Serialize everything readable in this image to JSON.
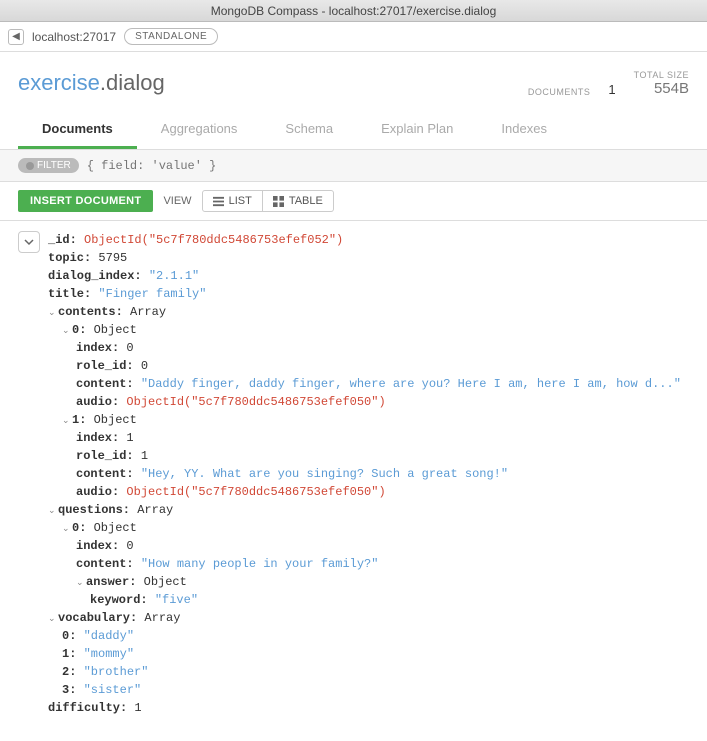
{
  "window": {
    "title": "MongoDB Compass - localhost:27017/exercise.dialog"
  },
  "connection": {
    "back_icon": "◀",
    "host": "localhost:27017",
    "mode": "STANDALONE"
  },
  "namespace": {
    "db": "exercise",
    "coll": ".dialog"
  },
  "stats": {
    "documents_label": "DOCUMENTS",
    "documents_value": "1",
    "size_label": "TOTAL SIZE",
    "size_value": "554B"
  },
  "tabs": {
    "documents": "Documents",
    "aggregations": "Aggregations",
    "schema": "Schema",
    "explain": "Explain Plan",
    "indexes": "Indexes"
  },
  "filter": {
    "badge": "FILTER",
    "placeholder": "{ field: 'value' }"
  },
  "toolbar": {
    "insert": "INSERT DOCUMENT",
    "view_label": "VIEW",
    "list": "LIST",
    "table": "TABLE"
  },
  "doc": {
    "id_key": "_id:",
    "id_val": "ObjectId(\"5c7f780ddc5486753efef052\")",
    "topic_key": "topic:",
    "topic_val": "5795",
    "dialog_index_key": "dialog_index:",
    "dialog_index_val": "\"2.1.1\"",
    "title_key": "title:",
    "title_val": "\"Finger family\"",
    "contents_key": "contents:",
    "contents_type": "Array",
    "c0_key": "0:",
    "c0_type": "Object",
    "c0_index_key": "index:",
    "c0_index_val": "0",
    "c0_role_key": "role_id:",
    "c0_role_val": "0",
    "c0_content_key": "content:",
    "c0_content_val": "\"Daddy finger, daddy finger, where are you? Here I am, here I am, how d...\"",
    "c0_audio_key": "audio:",
    "c0_audio_val": "ObjectId(\"5c7f780ddc5486753efef050\")",
    "c1_key": "1:",
    "c1_type": "Object",
    "c1_index_key": "index:",
    "c1_index_val": "1",
    "c1_role_key": "role_id:",
    "c1_role_val": "1",
    "c1_content_key": "content:",
    "c1_content_val": "\"Hey, YY. What are you singing? Such a great song!\"",
    "c1_audio_key": "audio:",
    "c1_audio_val": "ObjectId(\"5c7f780ddc5486753efef050\")",
    "questions_key": "questions:",
    "questions_type": "Array",
    "q0_key": "0:",
    "q0_type": "Object",
    "q0_index_key": "index:",
    "q0_index_val": "0",
    "q0_content_key": "content:",
    "q0_content_val": "\"How many people in your family?\"",
    "q0_answer_key": "answer:",
    "q0_answer_type": "Object",
    "q0_keyword_key": "keyword:",
    "q0_keyword_val": "\"five\"",
    "vocab_key": "vocabulary:",
    "vocab_type": "Array",
    "v0_key": "0:",
    "v0_val": "\"daddy\"",
    "v1_key": "1:",
    "v1_val": "\"mommy\"",
    "v2_key": "2:",
    "v2_val": "\"brother\"",
    "v3_key": "3:",
    "v3_val": "\"sister\"",
    "diff_key": "difficulty:",
    "diff_val": "1"
  }
}
